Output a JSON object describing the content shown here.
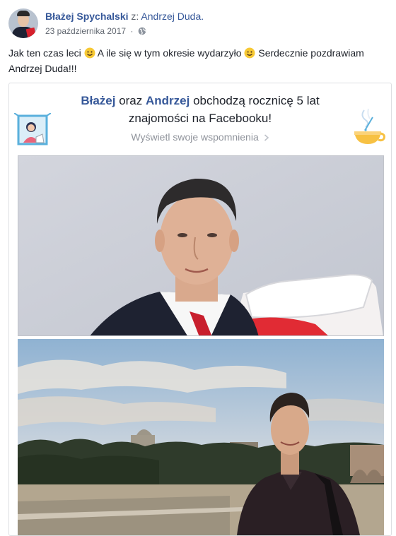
{
  "post": {
    "author": "Błażej Spychalski",
    "with_label": "z:",
    "target": "Andrzej Duda.",
    "date": "23 października 2017",
    "dot": "·",
    "text_part1": "Jak ten czas leci",
    "text_part2": "A ile się w tym okresie wydarzyło",
    "text_part3": "Serdecznie pozdrawiam Andrzej Duda!!!"
  },
  "card": {
    "name1": "Błażej",
    "conj": "oraz",
    "name2": "Andrzej",
    "title_rest": "obchodzą rocznicę 5 lat znajomości na Facebooku!",
    "link": "Wyświetl swoje wspomnienia"
  },
  "icons": {
    "avatar": "profile-photo",
    "audience": "globe-icon",
    "emoji1": "smile-emoji",
    "emoji2": "wink-emoji",
    "chevron": "chevron-right-icon",
    "left_deco": "friends-illustration",
    "right_deco": "coffee-cup-illustration"
  },
  "colors": {
    "link": "#365899",
    "meta": "#616770",
    "text": "#1d2129",
    "border": "#dddfe2"
  }
}
